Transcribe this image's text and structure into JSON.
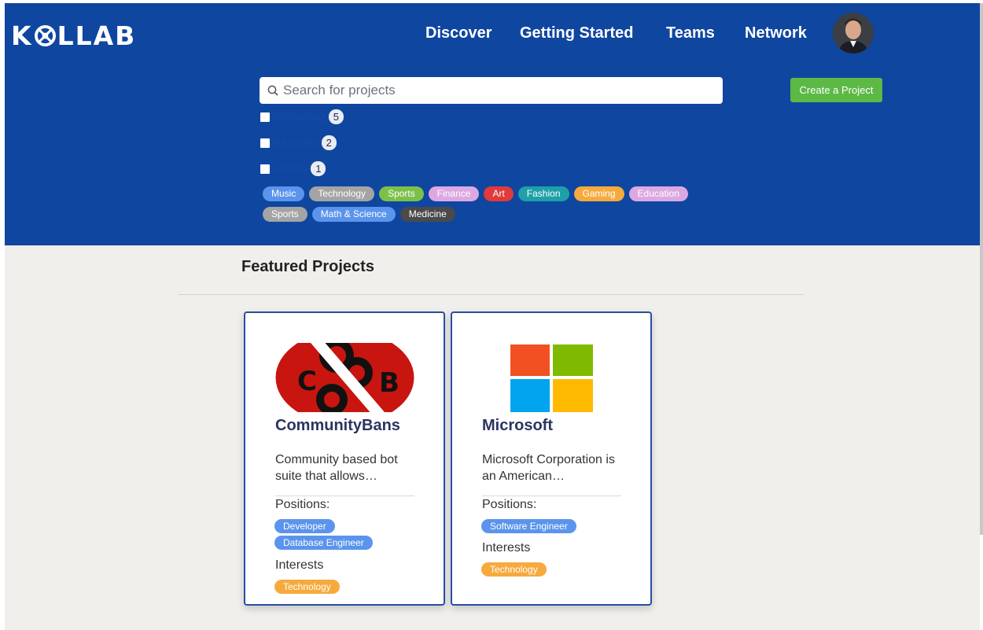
{
  "brand": {
    "logo_text": "KOLLAB"
  },
  "nav": {
    "items": [
      "Discover",
      "Getting Started",
      "Teams",
      "Network"
    ]
  },
  "search": {
    "placeholder": "Search for projects",
    "value": ""
  },
  "create_button": {
    "label": "Create a Project"
  },
  "filters": [
    {
      "label": "Technology",
      "count": "5",
      "checked": false
    },
    {
      "label": "Education",
      "count": "2",
      "checked": false
    },
    {
      "label": "Finance",
      "count": "1",
      "checked": false
    }
  ],
  "tags_row1": [
    {
      "label": "Music",
      "color": "#5b94ec"
    },
    {
      "label": "Technology",
      "color": "#a4a4a4"
    },
    {
      "label": "Sports",
      "color": "#7cc04a"
    },
    {
      "label": "Finance",
      "color": "#dca8e2"
    },
    {
      "label": "Art",
      "color": "#e03a3a"
    },
    {
      "label": "Fashion",
      "color": "#1ea0a8"
    },
    {
      "label": "Gaming",
      "color": "#f6aa3e"
    },
    {
      "label": "Education",
      "color": "#dca8e2"
    }
  ],
  "tags_row2": [
    {
      "label": "Sports",
      "color": "#a4a4a4"
    },
    {
      "label": "Math & Science",
      "color": "#5b94ec"
    },
    {
      "label": "Medicine",
      "color": "#4a4a4a"
    }
  ],
  "featured": {
    "title": "Featured Projects",
    "projects": [
      {
        "name": "CommunityBans",
        "description": "Community based bot suite that allows…",
        "positions_label": "Positions:",
        "positions": [
          "Developer",
          "Database Engineer"
        ],
        "interests_label": "Interests",
        "interests": [
          "Technology"
        ],
        "logo": "communitybans-logo",
        "logo_text": [
          "C",
          "B"
        ]
      },
      {
        "name": "Microsoft",
        "description": "Microsoft Corporation is an American…",
        "positions_label": "Positions:",
        "positions": [
          "Software Engineer"
        ],
        "interests_label": "Interests",
        "interests": [
          "Technology"
        ],
        "logo": "microsoft-logo"
      }
    ]
  },
  "colors": {
    "header_bg": "#0f46a0",
    "create_button": "#5cb946",
    "position_pill": "#5b94ec",
    "interest_pill": "#f6aa3e",
    "card_border": "#2650a4"
  }
}
